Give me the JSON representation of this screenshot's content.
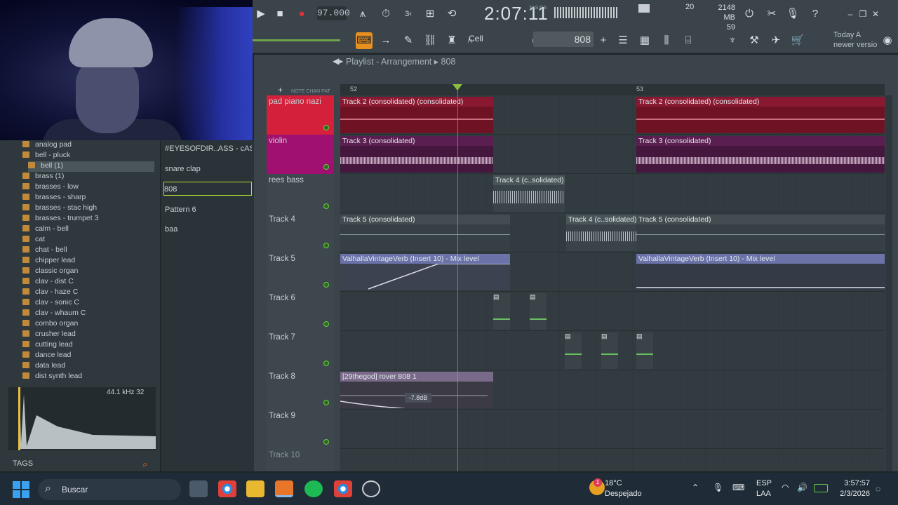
{
  "toolbar": {
    "tempo": "97.000",
    "time": "2:07:11",
    "time_unit": "M:S:CS",
    "cpu": "20",
    "memory": "2148 MB",
    "polyphony": "59",
    "cell_label": "Cell",
    "pattern": "808",
    "hint_line1": "Today A",
    "hint_line2": "newer versio"
  },
  "playlist": {
    "title": "Playlist - Arrangement",
    "pattern": "808",
    "bar52": "52",
    "bar53": "53",
    "tabs": [
      "NOTE",
      "CHAN",
      "PAT"
    ]
  },
  "browser": {
    "items": [
      "analog pad",
      "bell - pluck",
      "bell (1)",
      "brass (1)",
      "brasses - low",
      "brasses - sharp",
      "brasses - stac high",
      "brasses - trumpet 3",
      "calm - bell",
      "cat",
      "chat - bell",
      "chipper lead",
      "classic organ",
      "clav - dist C",
      "clav - haze C",
      "clav - sonic C",
      "clav - whaum C",
      "combo organ",
      "crusher lead",
      "cutting lead",
      "dance lead",
      "data lead",
      "dist synth lead"
    ],
    "sample_info": "44.1 kHz 32",
    "tags_label": "TAGS"
  },
  "channels": [
    "#EYESOFDIR..ASS - cASH",
    "snare clap",
    "808",
    "Pattern 6",
    "baa"
  ],
  "tracks": [
    "pad piano nazi",
    "violin",
    "rees bass",
    "Track 4",
    "Track 5",
    "Track 6",
    "Track 7",
    "Track 8",
    "Track 9",
    "Track 10"
  ],
  "clips": {
    "t2": "Track 2 (consolidated) (consolidated)",
    "t3": "Track 3 (consolidated)",
    "t4": "Track 4 (c..solidated)",
    "t5": "Track 5 (consolidated)",
    "auto": "ValhallaVintageVerb (Insert 10) - Mix level",
    "rover": "[29thegod] rover 808 1",
    "db": "-7.8dB"
  },
  "taskbar": {
    "search": "Buscar",
    "temp": "18°C",
    "weather": "Despejado",
    "lang1": "ESP",
    "lang2": "LAA",
    "clock": "3:57:57",
    "date": "2/3/2026",
    "badge": "1"
  },
  "colors": {
    "track_red": "#d4203a",
    "track_magenta": "#a01070",
    "clip_red": "#7a1428",
    "clip_purple": "#4a1a42",
    "auto": "#6a72a8"
  }
}
